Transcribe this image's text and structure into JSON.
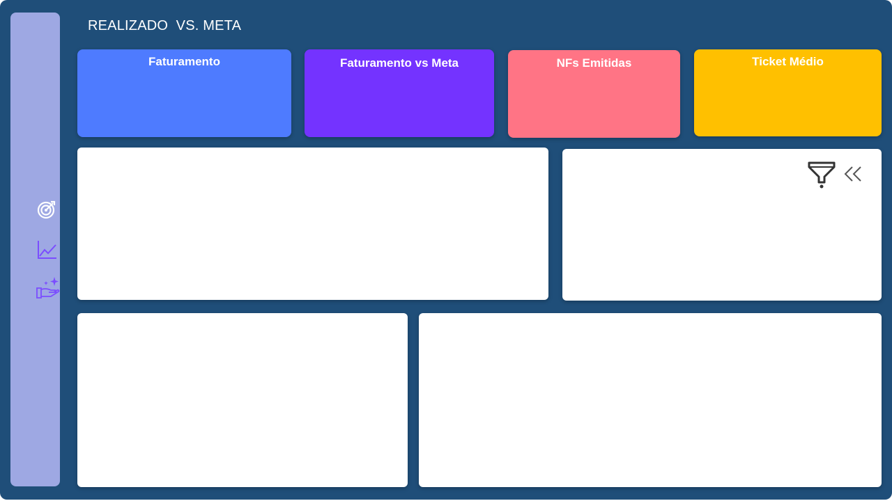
{
  "header": {
    "title": "REALIZADO  VS. META"
  },
  "sidebar": {
    "items": [
      {
        "icon": "target-icon",
        "color": "#ffffff"
      },
      {
        "icon": "line-chart-icon",
        "color": "#7b4dff"
      },
      {
        "icon": "hand-sparkle-icon",
        "color": "#7b4dff"
      }
    ]
  },
  "kpi_cards": [
    {
      "label": "Faturamento",
      "color": "#4e7bff"
    },
    {
      "label": "Faturamento vs Meta",
      "color": "#7433ff"
    },
    {
      "label": "NFs Emitidas",
      "color": "#ff7485"
    },
    {
      "label": "Ticket Médio",
      "color": "#ffc000"
    }
  ],
  "filter_panel": {
    "icons": [
      "filter-icon",
      "collapse-chevrons-icon"
    ]
  },
  "colors": {
    "background": "#1f4e79",
    "sidebar": "#9ea8e3",
    "panel": "#ffffff"
  }
}
